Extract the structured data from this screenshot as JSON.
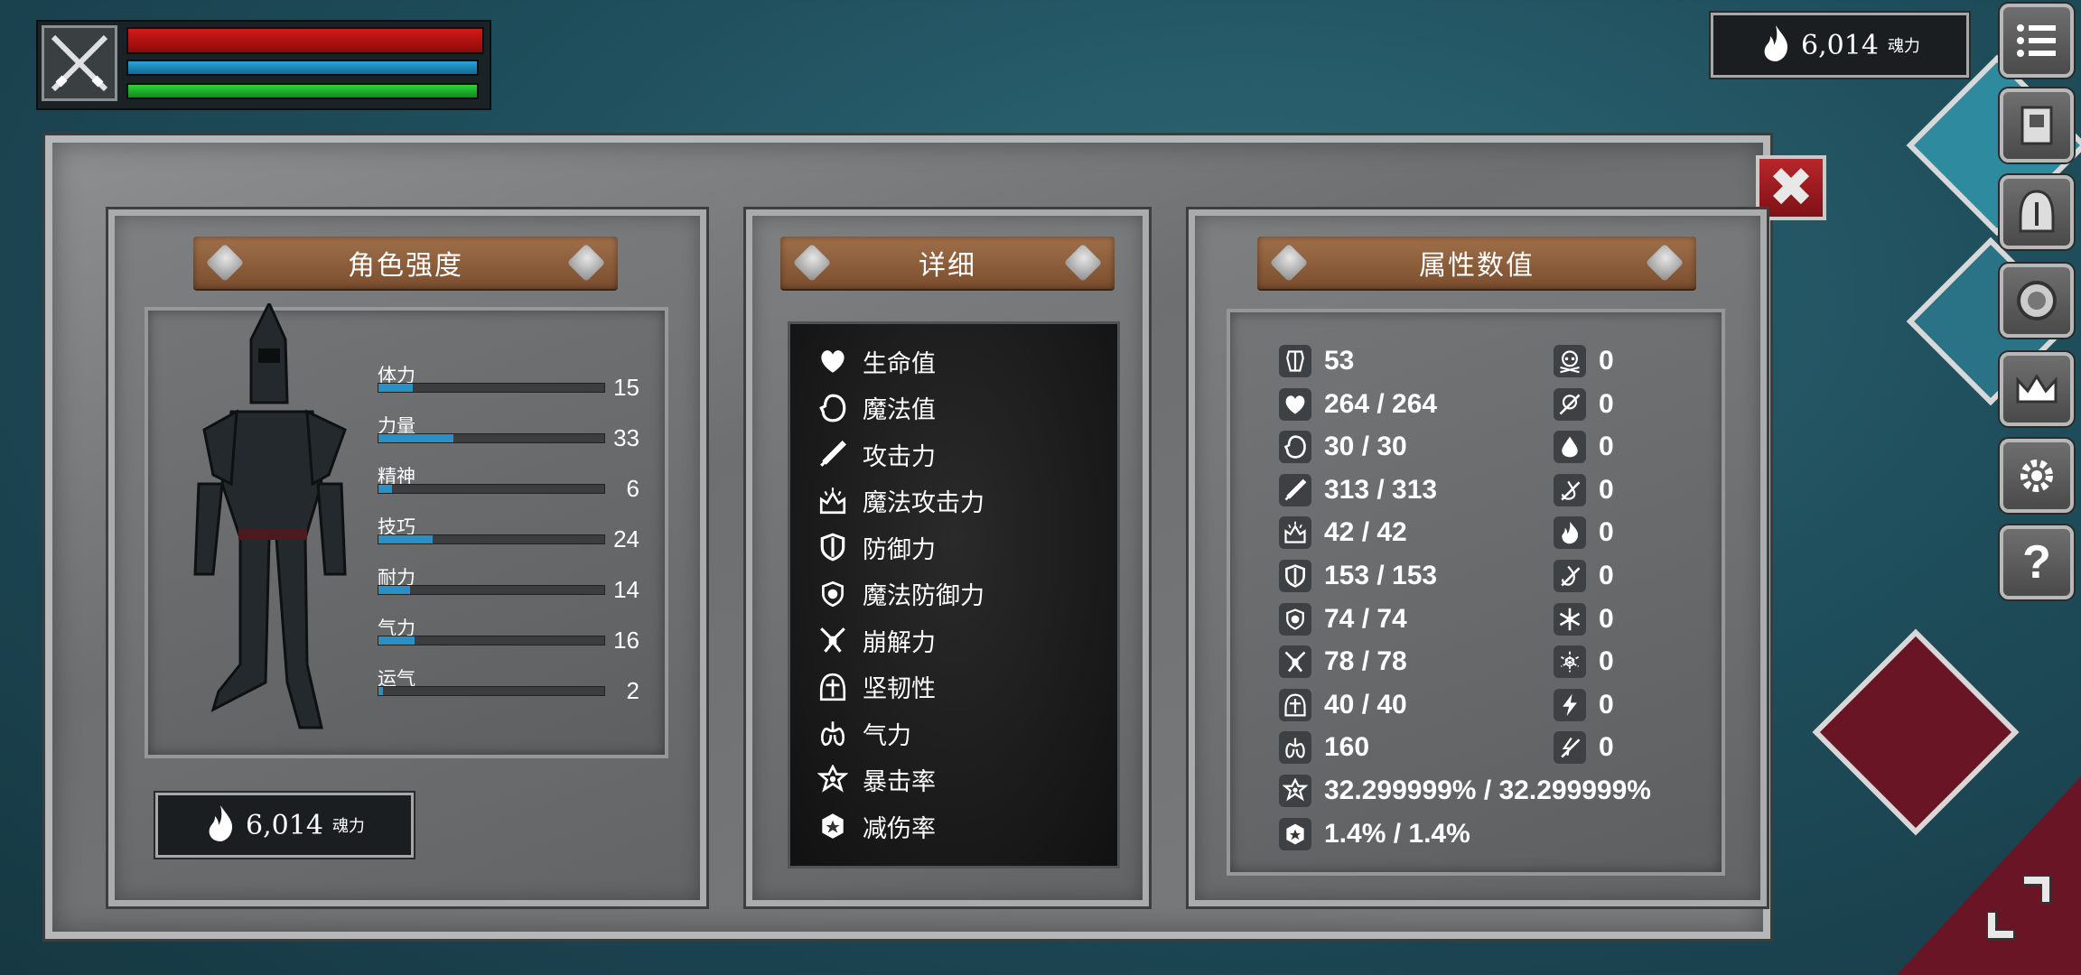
{
  "hud": {
    "weapon_icon": "crossed-swords-icon"
  },
  "soul": {
    "amount": "6,014",
    "unit": "魂力"
  },
  "panels": {
    "character": {
      "title": "角色强度"
    },
    "details": {
      "title": "详细"
    },
    "attributes": {
      "title": "属性数值"
    }
  },
  "stats": [
    {
      "label": "体力",
      "value": "15",
      "fill": 0.15
    },
    {
      "label": "力量",
      "value": "33",
      "fill": 0.33
    },
    {
      "label": "精神",
      "value": "6",
      "fill": 0.06
    },
    {
      "label": "技巧",
      "value": "24",
      "fill": 0.24
    },
    {
      "label": "耐力",
      "value": "14",
      "fill": 0.14
    },
    {
      "label": "气力",
      "value": "16",
      "fill": 0.16
    },
    {
      "label": "运气",
      "value": "2",
      "fill": 0.02
    }
  ],
  "details": [
    {
      "label": "生命值",
      "icon": "heart-icon"
    },
    {
      "label": "魔法值",
      "icon": "head-icon"
    },
    {
      "label": "攻击力",
      "icon": "sword-icon"
    },
    {
      "label": "魔法攻击力",
      "icon": "magic-attack-icon"
    },
    {
      "label": "防御力",
      "icon": "shield-icon"
    },
    {
      "label": "魔法防御力",
      "icon": "magic-defense-icon"
    },
    {
      "label": "崩解力",
      "icon": "break-icon"
    },
    {
      "label": "坚韧性",
      "icon": "helmet-icon"
    },
    {
      "label": "气力",
      "icon": "lungs-icon"
    },
    {
      "label": "暴击率",
      "icon": "critical-icon"
    },
    {
      "label": "减伤率",
      "icon": "damage-reduction-icon"
    }
  ],
  "attributes_left": [
    {
      "icon": "armor-icon",
      "value": "53"
    },
    {
      "icon": "heart-icon",
      "value": "264 / 264"
    },
    {
      "icon": "head-icon",
      "value": "30 / 30"
    },
    {
      "icon": "sword-icon",
      "value": "313 / 313"
    },
    {
      "icon": "magic-attack-icon",
      "value": "42 / 42"
    },
    {
      "icon": "shield-icon",
      "value": "153 / 153"
    },
    {
      "icon": "magic-defense-icon",
      "value": "74 / 74"
    },
    {
      "icon": "break-icon",
      "value": "78 / 78"
    },
    {
      "icon": "helmet-icon",
      "value": "40 / 40"
    },
    {
      "icon": "lungs-icon",
      "value": "160"
    },
    {
      "icon": "critical-icon",
      "value": "32.299999% / 32.299999%"
    },
    {
      "icon": "damage-reduction-icon",
      "value": "1.4% / 1.4%"
    }
  ],
  "attributes_right": [
    {
      "icon": "poison-skull-icon",
      "value": "0"
    },
    {
      "icon": "poison-resist-icon",
      "value": "0"
    },
    {
      "icon": "bleed-icon",
      "value": "0"
    },
    {
      "icon": "bleed-resist-icon",
      "value": "0"
    },
    {
      "icon": "fire-icon",
      "value": "0"
    },
    {
      "icon": "fire-resist-icon",
      "value": "0"
    },
    {
      "icon": "frost-icon",
      "value": "0"
    },
    {
      "icon": "frost-resist-icon",
      "value": "0"
    },
    {
      "icon": "lightning-icon",
      "value": "0"
    },
    {
      "icon": "lightning-resist-icon",
      "value": "0"
    }
  ],
  "menu": [
    "menu-list-icon",
    "journal-icon",
    "helmet-icon",
    "amulet-icon",
    "crown-icon",
    "settings-icon",
    "help-icon"
  ],
  "colors": {
    "hp": "#d21a1a",
    "mp": "#2aa4d8",
    "stamina": "#2bd43a",
    "stat_fill": "#2b8fc4",
    "close": "#b8262a",
    "plank": "#8a5a36"
  }
}
